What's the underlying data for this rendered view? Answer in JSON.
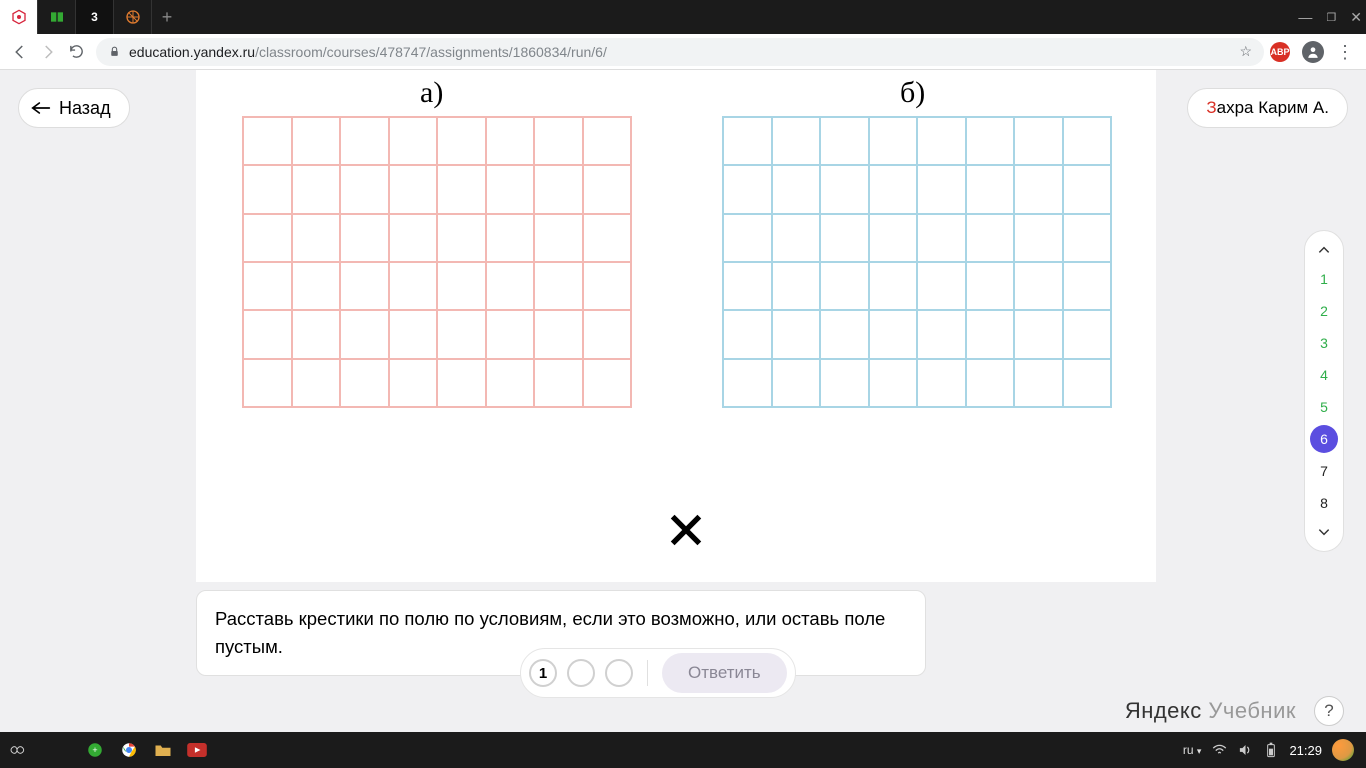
{
  "browser": {
    "tabs": [
      {
        "icon": "hex-red"
      },
      {
        "icon": "book-green"
      },
      {
        "icon": "num-3",
        "label": "3"
      },
      {
        "icon": "ball-orange"
      }
    ],
    "url_host": "education.yandex.ru",
    "url_path": "/classroom/courses/478747/assignments/1860834/run/6/",
    "abp_label": "ABP"
  },
  "page": {
    "back_label": "Назад",
    "user_first_letter": "З",
    "user_rest": "ахра Карим А.",
    "grid_a_label": "а)",
    "grid_b_label": "б)",
    "instruction": "Расставь крестики по полю по условиям, если это возможно, или оставь поле пустым.",
    "step_current": "1",
    "answer_btn": "Ответить",
    "brand_strong": "Яндекс",
    "brand_light": " Учебник",
    "help": "?"
  },
  "tasknav": {
    "items": [
      {
        "n": "1",
        "state": "done"
      },
      {
        "n": "2",
        "state": "done"
      },
      {
        "n": "3",
        "state": "done"
      },
      {
        "n": "4",
        "state": "done"
      },
      {
        "n": "5",
        "state": "done"
      },
      {
        "n": "6",
        "state": "current"
      },
      {
        "n": "7",
        "state": "future"
      },
      {
        "n": "8",
        "state": "future"
      }
    ]
  },
  "taskbar": {
    "lang": "ru",
    "clock": "21:29"
  }
}
